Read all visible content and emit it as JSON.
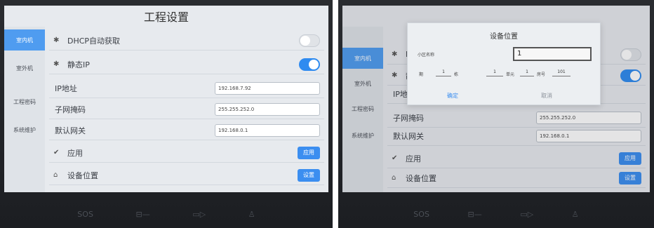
{
  "left": {
    "title": "工程设置",
    "sidebar": [
      "室内机",
      "室外机",
      "工程密码",
      "系统维护"
    ],
    "rows": {
      "dhcp": "DHCP自动获取",
      "static_ip": "静态IP",
      "ip_label": "IP地址",
      "ip_value": "192.168.7.92",
      "mask_label": "子网掩码",
      "mask_value": "255.255.252.0",
      "gw_label": "默认网关",
      "gw_value": "192.168.0.1",
      "apply_label": "应用",
      "apply_btn": "应用",
      "location_label": "设备位置",
      "location_btn": "设置"
    },
    "hardware": [
      "SOS",
      "⊟—",
      "▭▷",
      "♙"
    ]
  },
  "right": {
    "sidebar": [
      "室内机",
      "室外机",
      "工程密码",
      "系统维护"
    ],
    "rows": {
      "dhcp_partial": "DH",
      "static_partial": "静",
      "ip_partial": "IP地址",
      "mask_label": "子网掩码",
      "mask_value": "255.255.252.0",
      "gw_label": "默认网关",
      "gw_value": "192.168.0.1",
      "apply_label": "应用",
      "apply_btn": "应用",
      "location_label": "设备位置",
      "location_btn": "设置"
    },
    "dialog": {
      "title": "设备位置",
      "community_label": "小区名称",
      "community_value": "1",
      "period_label": "期",
      "period_value": "1",
      "building_label": "栋",
      "building_value": "1",
      "unit_label": "单元",
      "unit_value": "1",
      "room_label": "房号",
      "room_value": "101",
      "confirm": "确定",
      "cancel": "取消"
    },
    "hardware": [
      "SOS",
      "⊟—",
      "▭▷",
      "♙"
    ]
  }
}
